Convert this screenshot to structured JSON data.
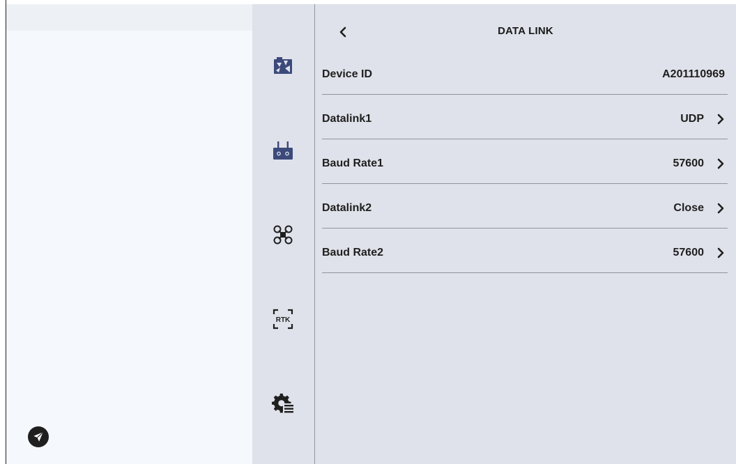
{
  "header": {
    "title": "DATA LINK"
  },
  "rail": {
    "icons": [
      "camera-settings-icon",
      "remote-controller-icon",
      "drone-icon",
      "rtk-icon",
      "system-settings-icon"
    ],
    "rtk_label": "RTK"
  },
  "rows": [
    {
      "label": "Device ID",
      "value": "A201110969",
      "has_chevron": false
    },
    {
      "label": "Datalink1",
      "value": "UDP",
      "has_chevron": true
    },
    {
      "label": "Baud Rate1",
      "value": "57600",
      "has_chevron": true
    },
    {
      "label": "Datalink2",
      "value": "Close",
      "has_chevron": true
    },
    {
      "label": "Baud Rate2",
      "value": "57600",
      "has_chevron": true
    }
  ],
  "colors": {
    "accent": "#3b4a7a",
    "text": "#1e1e1e",
    "panel": "#dfe2ea"
  }
}
